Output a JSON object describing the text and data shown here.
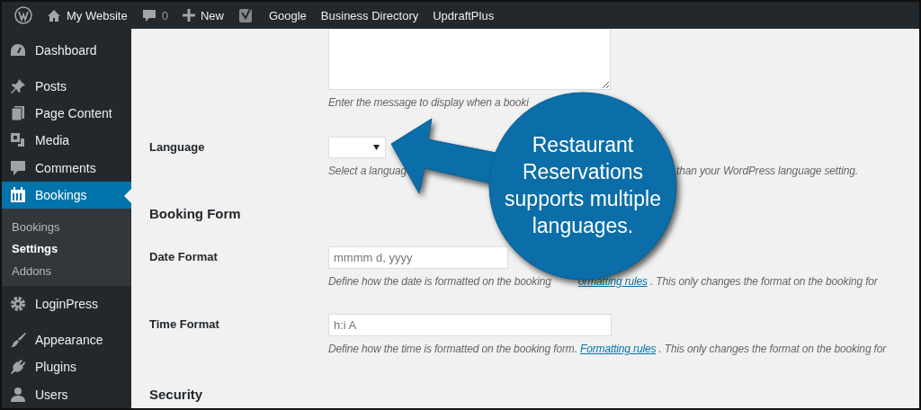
{
  "admin_bar": {
    "items": [
      {
        "kind": "logo"
      },
      {
        "kind": "home",
        "label": "My Website"
      },
      {
        "kind": "comments",
        "label": "0"
      },
      {
        "kind": "new",
        "label": "New"
      },
      {
        "kind": "seo"
      },
      {
        "kind": "text",
        "label": "Google"
      },
      {
        "kind": "text",
        "label": "Business Directory"
      },
      {
        "kind": "text",
        "label": "UpdraftPlus"
      }
    ]
  },
  "sidebar": {
    "items": [
      {
        "label": "Dashboard",
        "selected": false
      },
      {
        "label": "Posts",
        "selected": false
      },
      {
        "label": "Page Content",
        "selected": false
      },
      {
        "label": "Media",
        "selected": false
      },
      {
        "label": "Comments",
        "selected": false
      },
      {
        "label": "Bookings",
        "selected": true,
        "children": [
          {
            "label": "Bookings",
            "selected": false
          },
          {
            "label": "Settings",
            "selected": true
          },
          {
            "label": "Addons",
            "selected": false
          }
        ]
      },
      {
        "label": "LoginPress",
        "selected": false
      },
      {
        "label": "Appearance",
        "selected": false
      },
      {
        "label": "Plugins",
        "selected": false
      },
      {
        "label": "Users",
        "selected": false
      }
    ]
  },
  "settings": {
    "rows": [
      {
        "kind": "textarea",
        "description": [
          {
            "kind": "text",
            "text": "Enter the message to display when a booki"
          }
        ]
      },
      {
        "kind": "select",
        "label": "Language",
        "description": [
          {
            "kind": "text",
            "text": "Select a languag"
          },
          {
            "kind": "gap"
          },
          {
            "kind": "text",
            "text": "than your WordPress language setting."
          }
        ]
      },
      {
        "kind": "heading",
        "label": "Booking Form"
      },
      {
        "kind": "input",
        "label": "Date Format",
        "placeholder": "mmmm d, yyyy",
        "description": [
          {
            "kind": "text",
            "text": "Define how the date is formatted on the booking"
          },
          {
            "kind": "gap"
          },
          {
            "kind": "link",
            "text": "ormatting rules"
          },
          {
            "kind": "text",
            "text": ". This only changes the format on the booking for"
          }
        ]
      },
      {
        "kind": "input",
        "label": "Time Format",
        "placeholder": "h:i A",
        "description": [
          {
            "kind": "text",
            "text": "Define how the time is formatted on the booking form. "
          },
          {
            "kind": "link",
            "text": "Formatting rules"
          },
          {
            "kind": "text",
            "text": ". This only changes the format on the booking for"
          }
        ]
      },
      {
        "kind": "heading",
        "label": "Security"
      }
    ]
  },
  "callout": {
    "text": "Restaurant Reservations supports multiple languages."
  }
}
